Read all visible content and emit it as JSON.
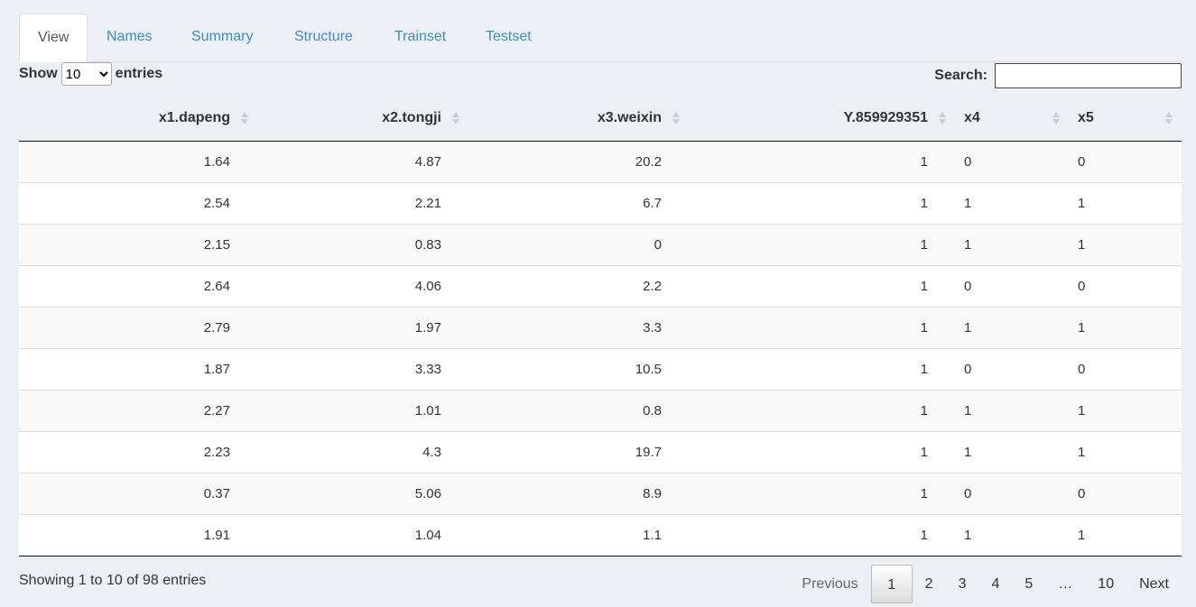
{
  "tabs": [
    {
      "label": "View",
      "active": true
    },
    {
      "label": "Names",
      "active": false
    },
    {
      "label": "Summary",
      "active": false
    },
    {
      "label": "Structure",
      "active": false
    },
    {
      "label": "Trainset",
      "active": false
    },
    {
      "label": "Testset",
      "active": false
    }
  ],
  "length": {
    "prefix": "Show",
    "selected": "10",
    "suffix": "entries"
  },
  "search": {
    "label": "Search:",
    "value": ""
  },
  "table": {
    "columns": [
      "x1.dapeng",
      "x2.tongji",
      "x3.weixin",
      "Y.859929351",
      "x4",
      "x5"
    ],
    "rows": [
      [
        "1.64",
        "4.87",
        "20.2",
        "1",
        "0",
        "0"
      ],
      [
        "2.54",
        "2.21",
        "6.7",
        "1",
        "1",
        "1"
      ],
      [
        "2.15",
        "0.83",
        "0",
        "1",
        "1",
        "1"
      ],
      [
        "2.64",
        "4.06",
        "2.2",
        "1",
        "0",
        "0"
      ],
      [
        "2.79",
        "1.97",
        "3.3",
        "1",
        "1",
        "1"
      ],
      [
        "1.87",
        "3.33",
        "10.5",
        "1",
        "0",
        "0"
      ],
      [
        "2.27",
        "1.01",
        "0.8",
        "1",
        "1",
        "1"
      ],
      [
        "2.23",
        "4.3",
        "19.7",
        "1",
        "1",
        "1"
      ],
      [
        "0.37",
        "5.06",
        "8.9",
        "1",
        "0",
        "0"
      ],
      [
        "1.91",
        "1.04",
        "1.1",
        "1",
        "1",
        "1"
      ]
    ]
  },
  "info": "Showing 1 to 10 of 98 entries",
  "pager": {
    "previous": "Previous",
    "pages": [
      "1",
      "2",
      "3",
      "4",
      "5",
      "…",
      "10"
    ],
    "current": "1",
    "next": "Next"
  }
}
